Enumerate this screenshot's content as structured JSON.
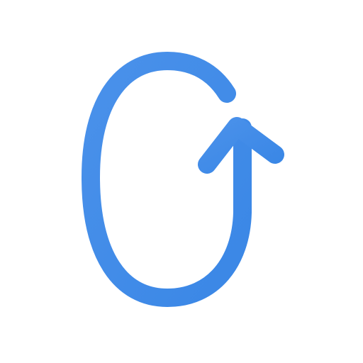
{
  "icon": {
    "name": "rotate-arrow-icon",
    "colors": {
      "stroke": "#3a87e6",
      "stroke_light": "#4a91ea",
      "background": "#ffffff"
    }
  }
}
